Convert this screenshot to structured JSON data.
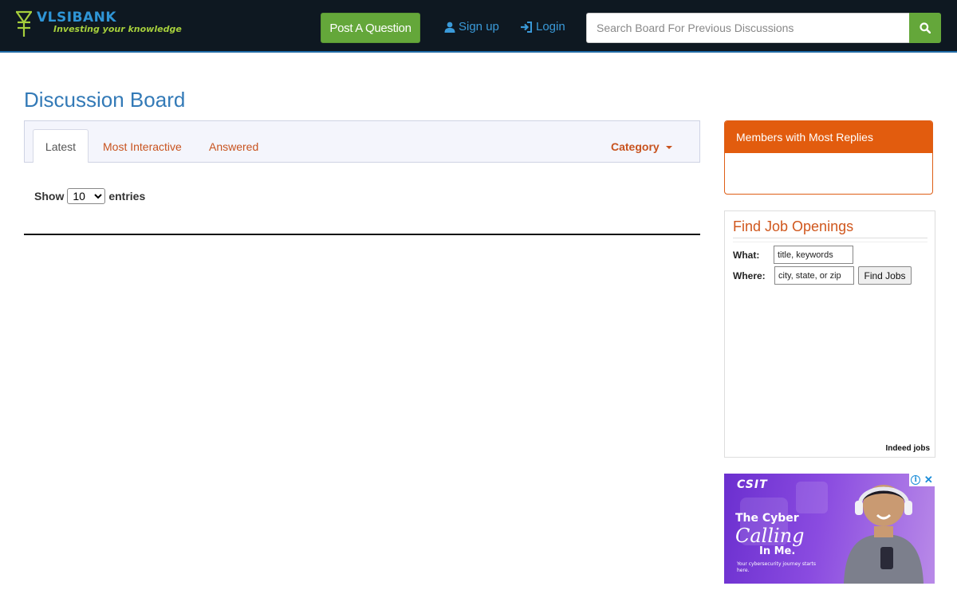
{
  "header": {
    "logo_main": "VLSIBANK",
    "logo_sub": "Investing your knowledge",
    "post_question": "Post A Question",
    "signup": "Sign up",
    "login": "Login",
    "search_placeholder": "Search Board For Previous Discussions",
    "icons": {
      "signup": "user-icon",
      "login": "sign-in-icon",
      "search": "search-icon"
    },
    "colors": {
      "bar": "#0e1821",
      "accent_green": "#64a73a",
      "link_blue": "#3a9ad9"
    }
  },
  "main": {
    "title": "Discussion Board",
    "tabs": [
      {
        "label": "Latest",
        "active": true
      },
      {
        "label": "Most Interactive",
        "active": false
      },
      {
        "label": "Answered",
        "active": false
      }
    ],
    "category_label": "Category",
    "show_label": "Show",
    "entries_label": "entries",
    "entries_value": "10",
    "entries_options": [
      "10"
    ]
  },
  "sidebar": {
    "members_title": "Members with Most Replies",
    "jobs": {
      "title": "Find Job Openings",
      "what_label": "What:",
      "what_value": "title, keywords",
      "where_label": "Where:",
      "where_value": "city, state, or zip",
      "button": "Find Jobs",
      "footer": "Indeed jobs"
    },
    "ad": {
      "logo": "CSIT",
      "line1": "The Cyber",
      "line2": "Calling",
      "line3": "In Me.",
      "line4": "Your cybersecurity journey starts here."
    }
  }
}
